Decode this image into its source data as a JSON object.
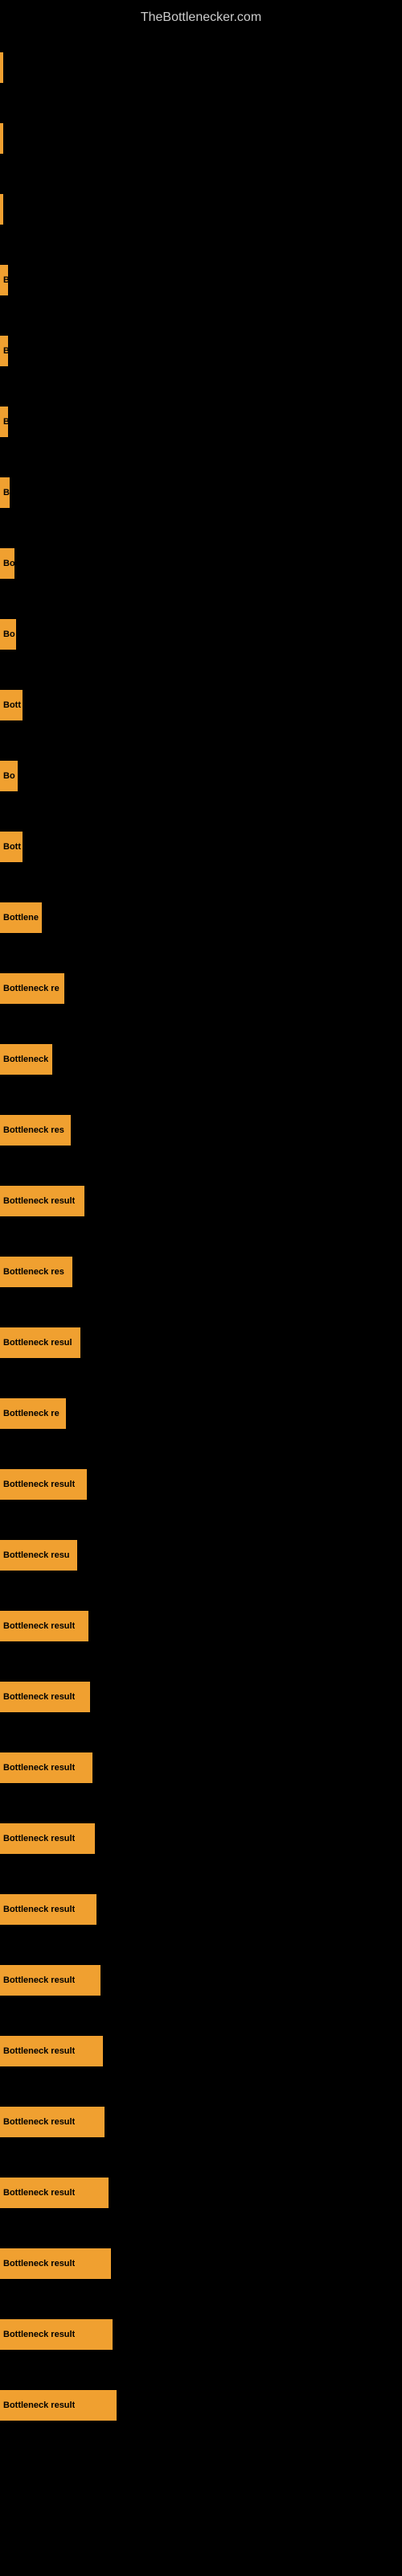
{
  "site": {
    "title": "TheBottlenecker.com"
  },
  "bars": [
    {
      "label": "|",
      "width": 4
    },
    {
      "label": "|",
      "width": 4
    },
    {
      "label": "|",
      "width": 4
    },
    {
      "label": "B",
      "width": 10
    },
    {
      "label": "B",
      "width": 10
    },
    {
      "label": "B",
      "width": 10
    },
    {
      "label": "B",
      "width": 12
    },
    {
      "label": "Bo",
      "width": 18
    },
    {
      "label": "Bo",
      "width": 20
    },
    {
      "label": "Bott",
      "width": 28
    },
    {
      "label": "Bo",
      "width": 22
    },
    {
      "label": "Bott",
      "width": 28
    },
    {
      "label": "Bottlene",
      "width": 52
    },
    {
      "label": "Bottleneck re",
      "width": 80
    },
    {
      "label": "Bottleneck",
      "width": 65
    },
    {
      "label": "Bottleneck res",
      "width": 88
    },
    {
      "label": "Bottleneck result",
      "width": 105
    },
    {
      "label": "Bottleneck res",
      "width": 90
    },
    {
      "label": "Bottleneck resul",
      "width": 100
    },
    {
      "label": "Bottleneck re",
      "width": 82
    },
    {
      "label": "Bottleneck result",
      "width": 108
    },
    {
      "label": "Bottleneck resu",
      "width": 96
    },
    {
      "label": "Bottleneck result",
      "width": 110
    },
    {
      "label": "Bottleneck result",
      "width": 112
    },
    {
      "label": "Bottleneck result",
      "width": 115
    },
    {
      "label": "Bottleneck result",
      "width": 118
    },
    {
      "label": "Bottleneck result",
      "width": 120
    },
    {
      "label": "Bottleneck result",
      "width": 125
    },
    {
      "label": "Bottleneck result",
      "width": 128
    },
    {
      "label": "Bottleneck result",
      "width": 130
    },
    {
      "label": "Bottleneck result",
      "width": 135
    },
    {
      "label": "Bottleneck result",
      "width": 138
    },
    {
      "label": "Bottleneck result",
      "width": 140
    },
    {
      "label": "Bottleneck result",
      "width": 145
    }
  ]
}
